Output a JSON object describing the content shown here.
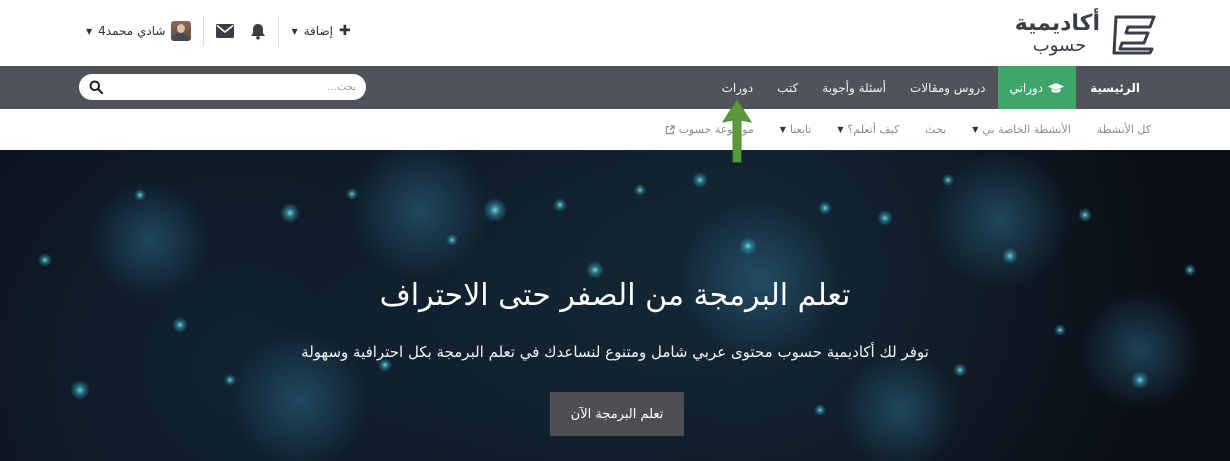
{
  "header": {
    "logo": {
      "title": "أكاديمية",
      "subtitle": "حسوب"
    },
    "user_bar": {
      "username": "شادي محمد4",
      "add_label": "إضافة"
    }
  },
  "navbar": {
    "items": [
      {
        "label": "الرئيسية"
      },
      {
        "label": "دوراتي"
      },
      {
        "label": "دروس ومقالات"
      },
      {
        "label": "أسئلة وأجوبة"
      },
      {
        "label": "كتب"
      },
      {
        "label": "دورات"
      }
    ],
    "search_placeholder": "بحث..."
  },
  "subnav": {
    "items": [
      {
        "label": "كل الأنشطة"
      },
      {
        "label": "الأنشطة الخاصة بي"
      },
      {
        "label": "بحث"
      },
      {
        "label": "كيف أتعلم؟"
      },
      {
        "label": "تابعنا"
      },
      {
        "label": "موسوعة حسوب"
      }
    ]
  },
  "hero": {
    "title": "تعلم البرمجة من الصفر حتى الاحتراف",
    "subtitle": "توفر لك أكاديمية حسوب محتوى عربي شامل ومتنوع لنساعدك في تعلم البرمجة بكل احترافية وسهولة",
    "button_label": "تعلم البرمجة الآن"
  },
  "colors": {
    "navbar_bg": "#50535a",
    "active_green": "#3fa66a",
    "hero_bg": "#0b1018",
    "arrow_green": "#5a9a3c"
  }
}
